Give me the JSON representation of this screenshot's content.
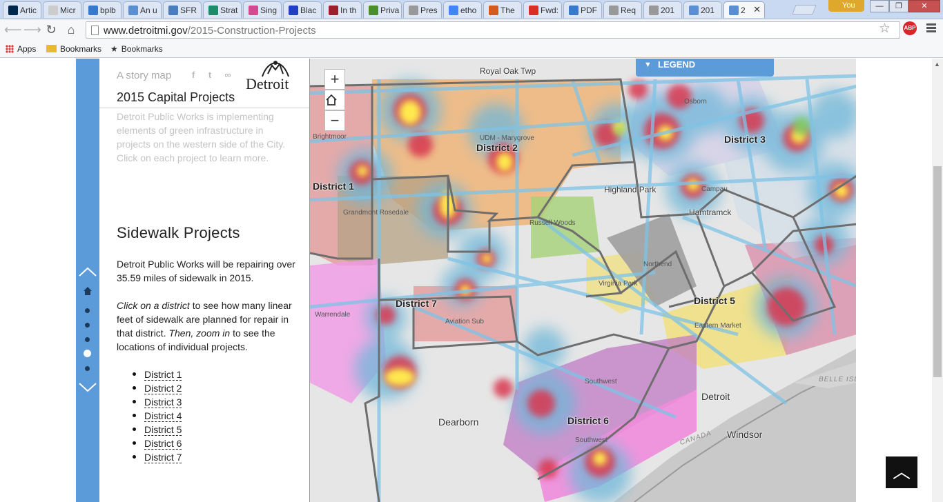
{
  "browser": {
    "tabs": [
      {
        "label": "Artic",
        "icon": "michigan-icon",
        "color": "#00274c"
      },
      {
        "label": "Micr",
        "icon": "blank-icon",
        "color": "#cccccc"
      },
      {
        "label": "bplb",
        "icon": "b-icon",
        "color": "#3a78c9"
      },
      {
        "label": "An u",
        "icon": "image-icon",
        "color": "#5a8fd2"
      },
      {
        "label": "SFR",
        "icon": "gear-icon",
        "color": "#4a7dbd"
      },
      {
        "label": "Strat",
        "icon": "triangle-icon",
        "color": "#1c8c6b"
      },
      {
        "label": "Sing",
        "icon": "dots-icon",
        "color": "#d04b8f"
      },
      {
        "label": "Blac",
        "icon": "b-blue-icon",
        "color": "#2140c4"
      },
      {
        "label": "In th",
        "icon": "triangle-red-icon",
        "color": "#9d1f2c"
      },
      {
        "label": "Priva",
        "icon": "grid-icon",
        "color": "#4a8f2a"
      },
      {
        "label": "Pres",
        "icon": "page-icon",
        "color": "#999999"
      },
      {
        "label": "etho",
        "icon": "google-icon",
        "color": "#4285f4"
      },
      {
        "label": "The",
        "icon": "arrow-icon",
        "color": "#d45a1f"
      },
      {
        "label": "Fwd:",
        "icon": "gmail-icon",
        "color": "#d93025"
      },
      {
        "label": "PDF",
        "icon": "b-icon",
        "color": "#3a78c9"
      },
      {
        "label": "Req",
        "icon": "page-icon",
        "color": "#999999"
      },
      {
        "label": "201",
        "icon": "page-icon",
        "color": "#999999"
      },
      {
        "label": "201",
        "icon": "image-icon",
        "color": "#5a8fd2"
      },
      {
        "label": "2",
        "icon": "image-icon",
        "color": "#5a8fd2",
        "active": true
      }
    ],
    "close_glyph": "✕",
    "profile_label": "You",
    "window": {
      "minimize": "—",
      "maximize": "❐",
      "close": "✕"
    },
    "url_host": "www.detroitmi.gov",
    "url_path": "/2015-Construction-Projects",
    "abp_label": "ABP",
    "bookmarks": [
      {
        "label": "Apps",
        "icon": "apps-icon"
      },
      {
        "label": "Bookmarks",
        "icon": "folder-icon"
      },
      {
        "label": "Bookmarks",
        "icon": "star-icon"
      }
    ]
  },
  "story": {
    "tagline": "A story map",
    "share_icons": [
      "facebook-icon",
      "twitter-icon",
      "link-icon"
    ],
    "logo_text": "Detroit",
    "title": "2015 Capital Projects",
    "intro": "Detroit Public Works is implementing elements of green infrastructure in projects on the western side of the City. Click on each project to learn more.",
    "section_title": "Sidewalk Projects",
    "para1": "Detroit Public Works will be repairing over 35.59 miles of sidewalk in 2015.",
    "para2_em1": "Click on a district",
    "para2_t1": " to see how many linear feet of sidewalk are planned for repair in that district. ",
    "para2_em2": "Then, zoom in",
    "para2_t2": " to see the locations of individual projects.",
    "districts": [
      "District 1",
      "District 2",
      "District 3",
      "District 4",
      "District 5",
      "District 6",
      "District 7"
    ]
  },
  "nav_rail": {
    "active_index": 3,
    "dot_count": 5
  },
  "map": {
    "zoom_in": "+",
    "zoom_out": "−",
    "legend_label": "LEGEND",
    "district_labels": [
      "District 1",
      "District 2",
      "District 3",
      "District 5",
      "District 6",
      "District 7"
    ],
    "places": [
      "Royal Oak Twp",
      "Highland Park",
      "Hamtramck",
      "Dearborn",
      "Detroit",
      "Windsor"
    ],
    "neighborhoods": [
      "UDM - Marygrove",
      "Grandmont Rosedale",
      "Russell Woods",
      "Northend",
      "Virginia Park",
      "Warrendale",
      "Aviation Sub",
      "Eastern Market",
      "Southwest",
      "Southwest",
      "Osborn",
      "Campau",
      "Brightmoor"
    ],
    "water_labels": [
      "BELLE ISL",
      "CANADA"
    ]
  },
  "scroll_to_top": "︿"
}
